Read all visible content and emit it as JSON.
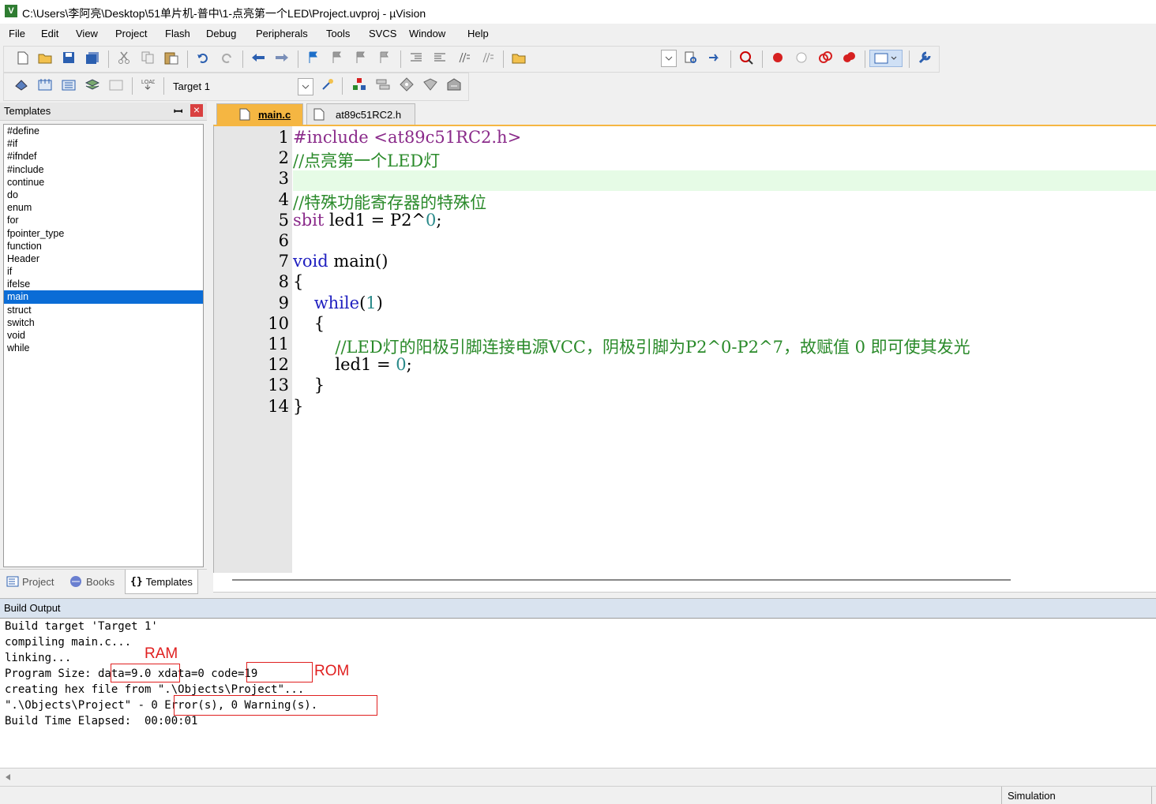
{
  "window": {
    "title": "C:\\Users\\李阿亮\\Desktop\\51单片机-普中\\1-点亮第一个LED\\Project.uvproj - µVision",
    "app_icon": "V"
  },
  "menu": [
    "File",
    "Edit",
    "View",
    "Project",
    "Flash",
    "Debug",
    "Peripherals",
    "Tools",
    "SVCS",
    "Window",
    "Help"
  ],
  "toolbar2": {
    "target": "Target 1"
  },
  "templates": {
    "title": "Templates",
    "pin_glyph": "ꟷ",
    "close_glyph": "×",
    "items": [
      "#define",
      "#if",
      "#ifndef",
      "#include",
      "continue",
      "do",
      "enum",
      "for",
      "fpointer_type",
      "function",
      "Header",
      "if",
      "ifelse",
      "main",
      "struct",
      "switch",
      "void",
      "while"
    ],
    "selected": "main"
  },
  "panel_tabs": [
    {
      "label": "Project",
      "icon": "project-icon"
    },
    {
      "label": "Books",
      "icon": "books-icon"
    },
    {
      "label": "Templates",
      "icon": "templates-icon",
      "glyph": "{}"
    }
  ],
  "editor": {
    "tabs": [
      {
        "label": "main.c",
        "active": true
      },
      {
        "label": "at89c51RC2.h",
        "active": false
      }
    ],
    "line_numbers": [
      "1",
      "2",
      "3",
      "4",
      "5",
      "6",
      "7",
      "8",
      "9",
      "10",
      "11",
      "12",
      "13",
      "14"
    ],
    "lines": [
      [
        {
          "t": "#include <at89c51RC2.h>",
          "c": "pp"
        }
      ],
      [
        {
          "t": "//点亮第一个LED灯",
          "c": "cm"
        }
      ],
      [
        {
          "t": "",
          "c": ""
        }
      ],
      [
        {
          "t": "//特殊功能寄存器的特殊位",
          "c": "cm"
        }
      ],
      [
        {
          "t": "sbit",
          "c": "pp"
        },
        {
          "t": " led1 = P2^",
          "c": ""
        },
        {
          "t": "0",
          "c": "num"
        },
        {
          "t": ";",
          "c": ""
        }
      ],
      [
        {
          "t": "",
          "c": ""
        }
      ],
      [
        {
          "t": "void",
          "c": "kw"
        },
        {
          "t": " main()",
          "c": ""
        }
      ],
      [
        {
          "t": "{",
          "c": ""
        }
      ],
      [
        {
          "t": "    ",
          "c": ""
        },
        {
          "t": "while",
          "c": "kw"
        },
        {
          "t": "(",
          "c": ""
        },
        {
          "t": "1",
          "c": "num"
        },
        {
          "t": ")",
          "c": ""
        }
      ],
      [
        {
          "t": "    {",
          "c": ""
        }
      ],
      [
        {
          "t": "        //LED灯的阳极引脚连接电源VCC，阴极引脚为P2^0-P2^7，故赋值 0 即可使其发光",
          "c": "cm"
        }
      ],
      [
        {
          "t": "        led1 = ",
          "c": ""
        },
        {
          "t": "0",
          "c": "num"
        },
        {
          "t": ";",
          "c": ""
        }
      ],
      [
        {
          "t": "    }",
          "c": ""
        }
      ],
      [
        {
          "t": "}",
          "c": ""
        }
      ]
    ]
  },
  "build_output": {
    "title": "Build Output",
    "lines": [
      "Build target 'Target 1'",
      "compiling main.c...",
      "linking...",
      "Program Size: data=9.0 xdata=0 code=19",
      "creating hex file from \".\\Objects\\Project\"...",
      "\".\\Objects\\Project\" - 0 Error(s), 0 Warning(s).",
      "Build Time Elapsed:  00:00:01"
    ],
    "annotations": {
      "ram": "RAM",
      "rom": "ROM"
    }
  },
  "status": {
    "mode": "Simulation"
  },
  "colors": {
    "selection": "#0a6cd6",
    "annotation": "#e02020",
    "active_tab": "#f5b642"
  }
}
